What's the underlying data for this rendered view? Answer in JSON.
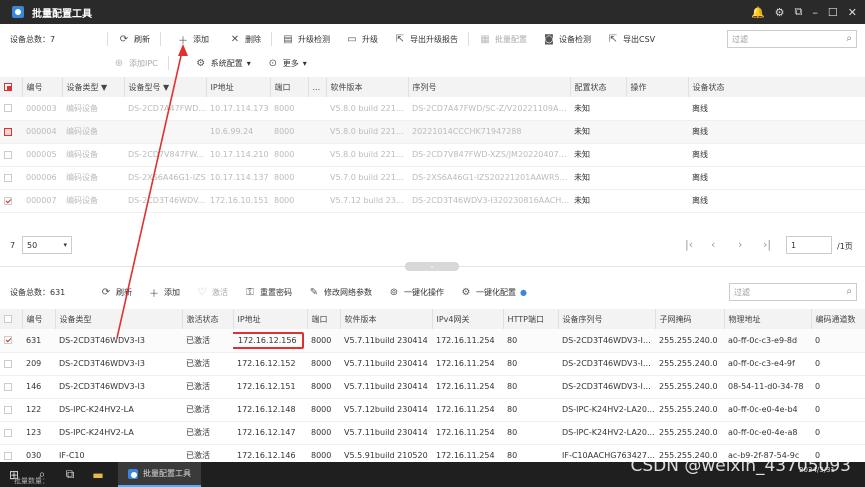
{
  "app": {
    "title": "批量配置工具"
  },
  "colors": {
    "titlebar": "#2a2a2a",
    "highlight": "#e03030",
    "accent": "#3a86d8"
  },
  "top": {
    "count_label": "设备总数：7",
    "buttons": {
      "refresh": "刷新",
      "add": "添加",
      "delete": "删除",
      "upgrade_check": "升级检测",
      "upgrade": "升级",
      "export_report": "导出升级报告",
      "batch_config": "批量配置",
      "device_check": "设备检测",
      "export_csv": "导出CSV",
      "add_ipc": "添加IPC",
      "system_config": "系统配置",
      "more": "更多"
    },
    "filter_placeholder": "过滤",
    "columns": [
      "编号",
      "设备类型",
      "设备型号",
      "IP地址",
      "端口",
      "...",
      "软件版本",
      "序列号",
      "配置状态",
      "操作",
      "设备状态"
    ],
    "rows": [
      {
        "id": "000003",
        "type": "编码设备",
        "model": "DS-2CD7A47FWD...",
        "ip": "10.17.114.173",
        "port": "8000",
        "version": "V5.8.0 build 221213",
        "serial": "DS-2CD7A47FWD/SC-Z/V20221109AAC...",
        "config": "未知",
        "op": "",
        "status": "离线"
      },
      {
        "id": "000004",
        "type": "编码设备",
        "model": "",
        "ip": "10.6.99.24",
        "port": "8000",
        "version": "V5.8.0 build 221028",
        "serial": "20221014CCCHK71947288",
        "config": "未知",
        "op": "",
        "status": "离线"
      },
      {
        "id": "000005",
        "type": "编码设备",
        "model": "DS-2CD7V847FW...",
        "ip": "10.17.114.210",
        "port": "8000",
        "version": "V5.8.0 build 221219",
        "serial": "DS-2CD7V847FWD-XZS/JM20220407AA...",
        "config": "未知",
        "op": "",
        "status": "离线"
      },
      {
        "id": "000006",
        "type": "编码设备",
        "model": "DS-2XS6A46G1-IZS",
        "ip": "10.17.114.137",
        "port": "8000",
        "version": "V5.7.0 build 221219",
        "serial": "DS-2XS6A46G1-IZS20221201AAWR5395...",
        "config": "未知",
        "op": "",
        "status": "离线"
      },
      {
        "id": "000007",
        "type": "编码设备",
        "model": "DS-2CD3T46WDV...",
        "ip": "172.16.10.151",
        "port": "8000",
        "version": "V5.7.12 build 230...",
        "serial": "DS-2CD3T46WDV3-I320230816AACHAF...",
        "config": "未知",
        "op": "",
        "status": "离线"
      }
    ],
    "pager": {
      "page_count_text": "7",
      "page_size": "50",
      "page_input": "1",
      "total_text": "/1页"
    }
  },
  "bottom": {
    "count_label": "设备总数：631",
    "buttons": {
      "refresh": "刷新",
      "add": "添加",
      "activate": "激活",
      "reset_password": "重置密码",
      "modify_network": "修改网络参数",
      "one_click_op": "一键化操作",
      "one_click_config": "一键化配置"
    },
    "filter_placeholder": "过滤",
    "columns": [
      "编号",
      "设备类型",
      "激活状态",
      "IP地址",
      "端口",
      "软件版本",
      "IPv4网关",
      "HTTP端口",
      "设备序列号",
      "子网掩码",
      "物理地址",
      "编码通道数"
    ],
    "rows": [
      {
        "id": "631",
        "type": "DS-2CD3T46WDV3-I3",
        "active": "已激活",
        "ip": "172.16.12.156",
        "port": "8000",
        "version": "V5.7.11build 230414",
        "gateway": "172.16.11.254",
        "http": "80",
        "serial": "DS-2CD3T46WDV3-I3...",
        "mask": "255.255.240.0",
        "mac": "a0-ff-0c-c3-e9-8d",
        "channels": "0"
      },
      {
        "id": "209",
        "type": "DS-2CD3T46WDV3-I3",
        "active": "已激活",
        "ip": "172.16.12.152",
        "port": "8000",
        "version": "V5.7.11build 230414",
        "gateway": "172.16.11.254",
        "http": "80",
        "serial": "DS-2CD3T46WDV3-I3...",
        "mask": "255.255.240.0",
        "mac": "a0-ff-0c-c3-e4-9f",
        "channels": "0"
      },
      {
        "id": "146",
        "type": "DS-2CD3T46WDV3-I3",
        "active": "已激活",
        "ip": "172.16.12.151",
        "port": "8000",
        "version": "V5.7.11build 230414",
        "gateway": "172.16.11.254",
        "http": "80",
        "serial": "DS-2CD3T46WDV3-I3...",
        "mask": "255.255.240.0",
        "mac": "08-54-11-d0-34-78",
        "channels": "0"
      },
      {
        "id": "122",
        "type": "DS-IPC-K24HV2-LA",
        "active": "已激活",
        "ip": "172.16.12.148",
        "port": "8000",
        "version": "V5.7.12build 230414",
        "gateway": "172.16.11.254",
        "http": "80",
        "serial": "DS-IPC-K24HV2-LA20...",
        "mask": "255.255.240.0",
        "mac": "a0-ff-0c-e0-4e-b4",
        "channels": "0"
      },
      {
        "id": "123",
        "type": "DS-IPC-K24HV2-LA",
        "active": "已激活",
        "ip": "172.16.12.147",
        "port": "8000",
        "version": "V5.7.11build 230414",
        "gateway": "172.16.11.254",
        "http": "80",
        "serial": "DS-IPC-K24HV2-LA20...",
        "mask": "255.255.240.0",
        "mac": "a0-ff-0c-e0-4e-a8",
        "channels": "0"
      },
      {
        "id": "030",
        "type": "IF-C10",
        "active": "已激活",
        "ip": "172.16.12.146",
        "port": "8000",
        "version": "V5.5.91build 210520",
        "gateway": "172.16.11.254",
        "http": "80",
        "serial": "IF-C10AACHG76342731",
        "mask": "255.255.240.0",
        "mac": "ac-b9-2f-87-54-9c",
        "channels": "0"
      }
    ]
  },
  "taskbar": {
    "app_label": "批量配置工具",
    "time": "",
    "date": "2024/3/31",
    "strip_text": "批量数量："
  },
  "watermark": "CSDN @weixin_43705093"
}
